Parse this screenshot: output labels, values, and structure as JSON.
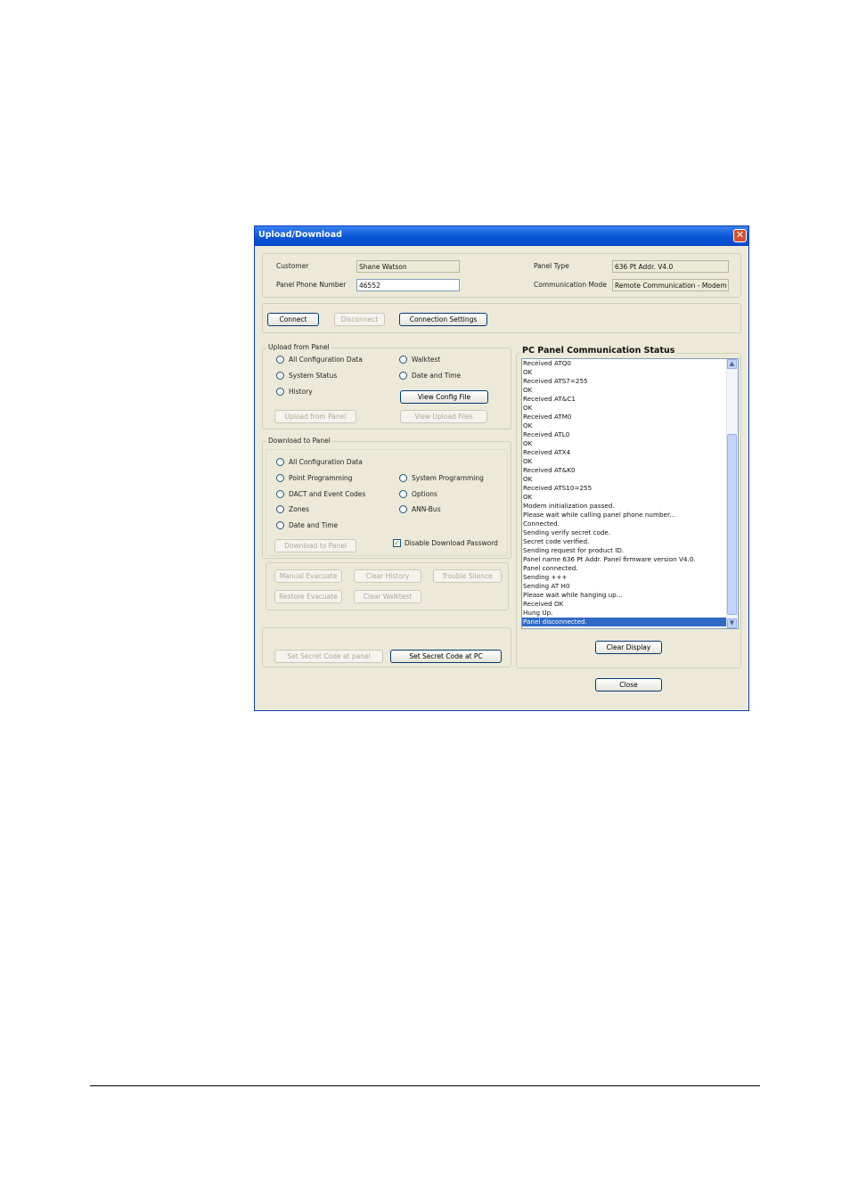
{
  "window": {
    "title": "Upload/Download",
    "close_glyph": "✕"
  },
  "info": {
    "customer_label": "Customer",
    "customer_value": "Shane Watson",
    "phone_label": "Panel Phone Number",
    "phone_value": "46552",
    "panel_type_label": "Panel Type",
    "panel_type_value": "636 Pt Addr. V4.0",
    "comm_mode_label": "Communication Mode",
    "comm_mode_value": "Remote Communication - Modem"
  },
  "connection": {
    "connect": "Connect",
    "disconnect": "Disconnect",
    "settings": "Connection Settings"
  },
  "upload": {
    "legend": "Upload from Panel",
    "options": [
      "All Configuration Data",
      "System Status",
      "History",
      "Walktest",
      "Date and Time"
    ],
    "view_config": "View Config File",
    "upload_button": "Upload from Panel",
    "view_upload": "View Upload Files"
  },
  "download": {
    "legend": "Download to Panel",
    "options": [
      "All Configuration Data",
      "Point Programming",
      "DACT and Event Codes",
      "Zones",
      "Date and Time",
      "System Programming",
      "Options",
      "ANN-Bus"
    ],
    "download_button": "Download to Panel",
    "disable_password": "Disable Download Password",
    "disable_checked": "✓"
  },
  "actions": {
    "manual_evacuate": "Manual Evacuate",
    "clear_history": "Clear History",
    "trouble_silence": "Trouble Silence",
    "restore_evacuate": "Restore Evacuate",
    "clear_walktest": "Clear Walktest"
  },
  "secret": {
    "at_panel": "Set Secret Code at panel",
    "at_pc": "Set Secret Code at PC"
  },
  "status": {
    "title": "PC Panel Communication Status",
    "lines": [
      "Received ATQ0",
      "OK",
      "Received ATS7=255",
      "OK",
      "Received AT&C1",
      "OK",
      "Received ATM0",
      "OK",
      "Received ATL0",
      "OK",
      "Received ATX4",
      "OK",
      "Received AT&K0",
      "OK",
      "Received ATS10=255",
      "OK",
      "Modem initialization passed.",
      "Please wait while calling panel phone number...",
      "Connected.",
      "Sending verify secret code.",
      "Secret code verified.",
      "Sending request for product ID.",
      "Panel name 636 Pt Addr. Panel firmware version V4.0.",
      "Panel connected.",
      "Sending +++",
      "Sending AT H0",
      "Please wait while hanging up...",
      "Received    OK",
      "Hung Up.",
      "Panel disconnected."
    ],
    "selected_index": 29,
    "scroll_up": "▲",
    "scroll_down": "▼",
    "clear_display": "Clear Display"
  },
  "close_button": "Close"
}
